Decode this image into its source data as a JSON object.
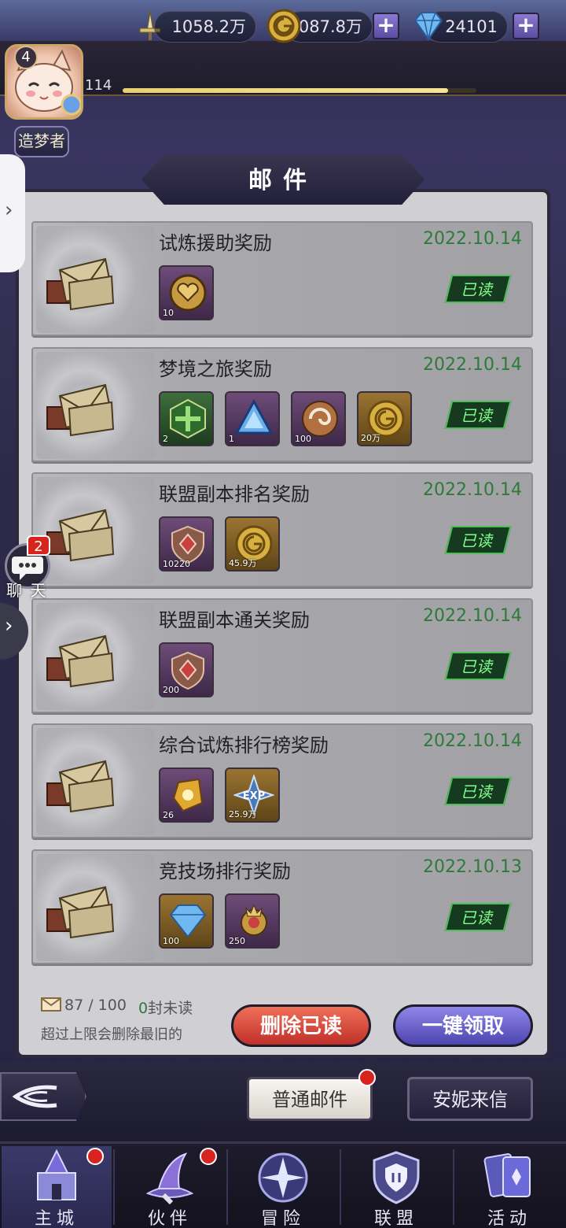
{
  "player": {
    "level": "4",
    "level_num": "114",
    "title": "造梦者",
    "xp_progress": 0.92
  },
  "resources": {
    "power": "1058.2万",
    "gold": "8087.8万",
    "diamonds": "24101"
  },
  "header": {
    "title": "邮件"
  },
  "mails": [
    {
      "title": "试炼援助奖励",
      "date": "2022.10.14",
      "status": "已读",
      "items": [
        {
          "icon": "heart-coin-icon",
          "qty": "10",
          "style": "purple"
        }
      ]
    },
    {
      "title": "梦境之旅奖励",
      "date": "2022.10.14",
      "status": "已读",
      "items": [
        {
          "icon": "green-emblem-icon",
          "qty": "2",
          "style": "green"
        },
        {
          "icon": "blue-gem-icon",
          "qty": "1",
          "style": "purple"
        },
        {
          "icon": "swirl-orb-icon",
          "qty": "100",
          "style": "purple"
        },
        {
          "icon": "gold-coin-icon",
          "qty": "20万",
          "style": "gold"
        }
      ]
    },
    {
      "title": "联盟副本排名奖励",
      "date": "2022.10.14",
      "status": "已读",
      "items": [
        {
          "icon": "alliance-badge-icon",
          "qty": "10220",
          "style": "purple"
        },
        {
          "icon": "gold-coin-icon",
          "qty": "45.9万",
          "style": "gold"
        }
      ]
    },
    {
      "title": "联盟副本通关奖励",
      "date": "2022.10.14",
      "status": "已读",
      "items": [
        {
          "icon": "alliance-badge-icon",
          "qty": "200",
          "style": "purple"
        }
      ]
    },
    {
      "title": "综合试炼排行榜奖励",
      "date": "2022.10.14",
      "status": "已读",
      "items": [
        {
          "icon": "gold-rune-icon",
          "qty": "26",
          "style": "purple"
        },
        {
          "icon": "exp-star-icon",
          "qty": "25.9万",
          "style": "gold"
        }
      ]
    },
    {
      "title": "竞技场排行奖励",
      "date": "2022.10.13",
      "status": "已读",
      "items": [
        {
          "icon": "diamond-icon",
          "qty": "100",
          "style": "gold"
        },
        {
          "icon": "arena-crest-icon",
          "qty": "250",
          "style": "purple"
        }
      ]
    }
  ],
  "footer": {
    "mail_count": "87 / 100",
    "unread_count": "0",
    "unread_suffix": "封未读",
    "warning": "超过上限会删除最旧的",
    "delete_read": "删除已读",
    "claim_all": "一键领取"
  },
  "tabs": {
    "normal": "普通邮件",
    "annie": "安妮来信"
  },
  "chat": {
    "label": "聊 天",
    "badge": "2"
  },
  "nav": [
    {
      "label": "主城",
      "icon": "castle-icon",
      "dot": true
    },
    {
      "label": "伙伴",
      "icon": "witch-hat-icon",
      "dot": true
    },
    {
      "label": "冒险",
      "icon": "compass-orb-icon",
      "dot": false
    },
    {
      "label": "联盟",
      "icon": "shield-icon",
      "dot": false
    },
    {
      "label": "活动",
      "icon": "cards-icon",
      "dot": false
    }
  ],
  "colors": {
    "date_green": "#2d7a3a",
    "read_badge": "#163a20",
    "accent_red": "#d8241e"
  }
}
